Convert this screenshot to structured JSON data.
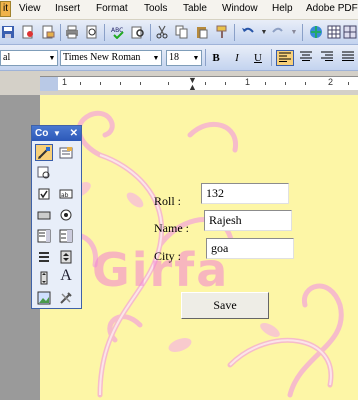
{
  "menu": [
    {
      "label": "it",
      "key": "menu-edit",
      "active": true
    },
    {
      "label": "View",
      "key": "menu-view"
    },
    {
      "label": "Insert",
      "key": "menu-insert"
    },
    {
      "label": "Format",
      "key": "menu-format"
    },
    {
      "label": "Tools",
      "key": "menu-tools"
    },
    {
      "label": "Table",
      "key": "menu-table"
    },
    {
      "label": "Window",
      "key": "menu-window"
    },
    {
      "label": "Help",
      "key": "menu-help"
    },
    {
      "label": "Adobe PDF",
      "key": "menu-adobe-pdf"
    }
  ],
  "formatting": {
    "style_value": "al",
    "font_value": "Times New Roman",
    "size_value": "18",
    "bold": "B",
    "italic": "I",
    "underline": "U"
  },
  "ruler": {
    "labels": [
      "1",
      "1",
      "2"
    ]
  },
  "toolbox": {
    "title": "Co",
    "dropdown_glyph": "▼",
    "close_glyph": "✕"
  },
  "form": {
    "roll_label": "Roll :",
    "roll_value": "132",
    "name_label": "Name :",
    "name_value": "Rajesh",
    "city_label": "City :",
    "city_value": "goa",
    "save_label": "Save"
  },
  "watermark": "Girfa",
  "colors": {
    "page_background": "#fdf6a6",
    "toolbar_gradient_top": "#e9eef8",
    "toolbar_gradient_bottom": "#c3d3ef",
    "active_highlight": "#f7d07a"
  }
}
